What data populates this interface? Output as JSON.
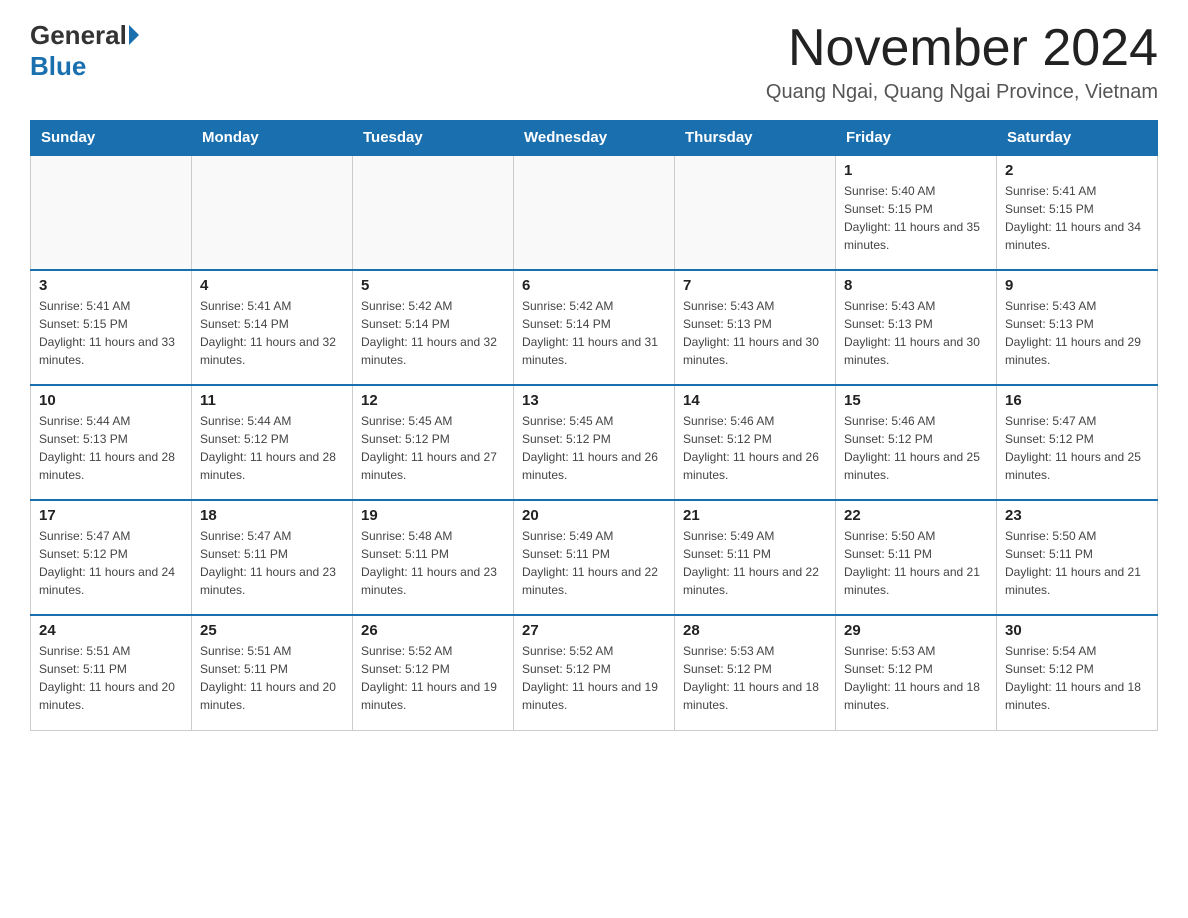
{
  "logo": {
    "general": "General",
    "blue": "Blue"
  },
  "title": "November 2024",
  "location": "Quang Ngai, Quang Ngai Province, Vietnam",
  "headers": [
    "Sunday",
    "Monday",
    "Tuesday",
    "Wednesday",
    "Thursday",
    "Friday",
    "Saturday"
  ],
  "weeks": [
    [
      {
        "day": "",
        "info": ""
      },
      {
        "day": "",
        "info": ""
      },
      {
        "day": "",
        "info": ""
      },
      {
        "day": "",
        "info": ""
      },
      {
        "day": "",
        "info": ""
      },
      {
        "day": "1",
        "info": "Sunrise: 5:40 AM\nSunset: 5:15 PM\nDaylight: 11 hours and 35 minutes."
      },
      {
        "day": "2",
        "info": "Sunrise: 5:41 AM\nSunset: 5:15 PM\nDaylight: 11 hours and 34 minutes."
      }
    ],
    [
      {
        "day": "3",
        "info": "Sunrise: 5:41 AM\nSunset: 5:15 PM\nDaylight: 11 hours and 33 minutes."
      },
      {
        "day": "4",
        "info": "Sunrise: 5:41 AM\nSunset: 5:14 PM\nDaylight: 11 hours and 32 minutes."
      },
      {
        "day": "5",
        "info": "Sunrise: 5:42 AM\nSunset: 5:14 PM\nDaylight: 11 hours and 32 minutes."
      },
      {
        "day": "6",
        "info": "Sunrise: 5:42 AM\nSunset: 5:14 PM\nDaylight: 11 hours and 31 minutes."
      },
      {
        "day": "7",
        "info": "Sunrise: 5:43 AM\nSunset: 5:13 PM\nDaylight: 11 hours and 30 minutes."
      },
      {
        "day": "8",
        "info": "Sunrise: 5:43 AM\nSunset: 5:13 PM\nDaylight: 11 hours and 30 minutes."
      },
      {
        "day": "9",
        "info": "Sunrise: 5:43 AM\nSunset: 5:13 PM\nDaylight: 11 hours and 29 minutes."
      }
    ],
    [
      {
        "day": "10",
        "info": "Sunrise: 5:44 AM\nSunset: 5:13 PM\nDaylight: 11 hours and 28 minutes."
      },
      {
        "day": "11",
        "info": "Sunrise: 5:44 AM\nSunset: 5:12 PM\nDaylight: 11 hours and 28 minutes."
      },
      {
        "day": "12",
        "info": "Sunrise: 5:45 AM\nSunset: 5:12 PM\nDaylight: 11 hours and 27 minutes."
      },
      {
        "day": "13",
        "info": "Sunrise: 5:45 AM\nSunset: 5:12 PM\nDaylight: 11 hours and 26 minutes."
      },
      {
        "day": "14",
        "info": "Sunrise: 5:46 AM\nSunset: 5:12 PM\nDaylight: 11 hours and 26 minutes."
      },
      {
        "day": "15",
        "info": "Sunrise: 5:46 AM\nSunset: 5:12 PM\nDaylight: 11 hours and 25 minutes."
      },
      {
        "day": "16",
        "info": "Sunrise: 5:47 AM\nSunset: 5:12 PM\nDaylight: 11 hours and 25 minutes."
      }
    ],
    [
      {
        "day": "17",
        "info": "Sunrise: 5:47 AM\nSunset: 5:12 PM\nDaylight: 11 hours and 24 minutes."
      },
      {
        "day": "18",
        "info": "Sunrise: 5:47 AM\nSunset: 5:11 PM\nDaylight: 11 hours and 23 minutes."
      },
      {
        "day": "19",
        "info": "Sunrise: 5:48 AM\nSunset: 5:11 PM\nDaylight: 11 hours and 23 minutes."
      },
      {
        "day": "20",
        "info": "Sunrise: 5:49 AM\nSunset: 5:11 PM\nDaylight: 11 hours and 22 minutes."
      },
      {
        "day": "21",
        "info": "Sunrise: 5:49 AM\nSunset: 5:11 PM\nDaylight: 11 hours and 22 minutes."
      },
      {
        "day": "22",
        "info": "Sunrise: 5:50 AM\nSunset: 5:11 PM\nDaylight: 11 hours and 21 minutes."
      },
      {
        "day": "23",
        "info": "Sunrise: 5:50 AM\nSunset: 5:11 PM\nDaylight: 11 hours and 21 minutes."
      }
    ],
    [
      {
        "day": "24",
        "info": "Sunrise: 5:51 AM\nSunset: 5:11 PM\nDaylight: 11 hours and 20 minutes."
      },
      {
        "day": "25",
        "info": "Sunrise: 5:51 AM\nSunset: 5:11 PM\nDaylight: 11 hours and 20 minutes."
      },
      {
        "day": "26",
        "info": "Sunrise: 5:52 AM\nSunset: 5:12 PM\nDaylight: 11 hours and 19 minutes."
      },
      {
        "day": "27",
        "info": "Sunrise: 5:52 AM\nSunset: 5:12 PM\nDaylight: 11 hours and 19 minutes."
      },
      {
        "day": "28",
        "info": "Sunrise: 5:53 AM\nSunset: 5:12 PM\nDaylight: 11 hours and 18 minutes."
      },
      {
        "day": "29",
        "info": "Sunrise: 5:53 AM\nSunset: 5:12 PM\nDaylight: 11 hours and 18 minutes."
      },
      {
        "day": "30",
        "info": "Sunrise: 5:54 AM\nSunset: 5:12 PM\nDaylight: 11 hours and 18 minutes."
      }
    ]
  ]
}
